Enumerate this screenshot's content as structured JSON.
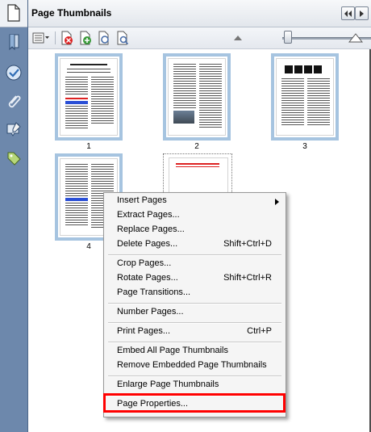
{
  "panel": {
    "title": "Page Thumbnails"
  },
  "thumbnails": [
    {
      "label": "1"
    },
    {
      "label": "2"
    },
    {
      "label": "3"
    },
    {
      "label": "4"
    }
  ],
  "context_menu": {
    "items": [
      {
        "label": "Insert Pages",
        "shortcut": "",
        "submenu": true
      },
      {
        "label": "Extract Pages...",
        "shortcut": ""
      },
      {
        "label": "Replace Pages...",
        "shortcut": ""
      },
      {
        "label": "Delete Pages...",
        "shortcut": "Shift+Ctrl+D"
      },
      {
        "label": "Crop Pages...",
        "shortcut": ""
      },
      {
        "label": "Rotate Pages...",
        "shortcut": "Shift+Ctrl+R"
      },
      {
        "label": "Page Transitions...",
        "shortcut": ""
      },
      {
        "label": "Number Pages...",
        "shortcut": ""
      },
      {
        "label": "Print Pages...",
        "shortcut": "Ctrl+P"
      },
      {
        "label": "Embed All Page Thumbnails",
        "shortcut": ""
      },
      {
        "label": "Remove Embedded Page Thumbnails",
        "shortcut": ""
      },
      {
        "label": "Enlarge Page Thumbnails",
        "shortcut": ""
      },
      {
        "label": "Page Properties...",
        "shortcut": "",
        "highlighted": true
      }
    ]
  },
  "colors": {
    "accent_highlight": "#ff0000",
    "thumb_border": "#a6c4e0",
    "rail": "#6d88ac"
  }
}
